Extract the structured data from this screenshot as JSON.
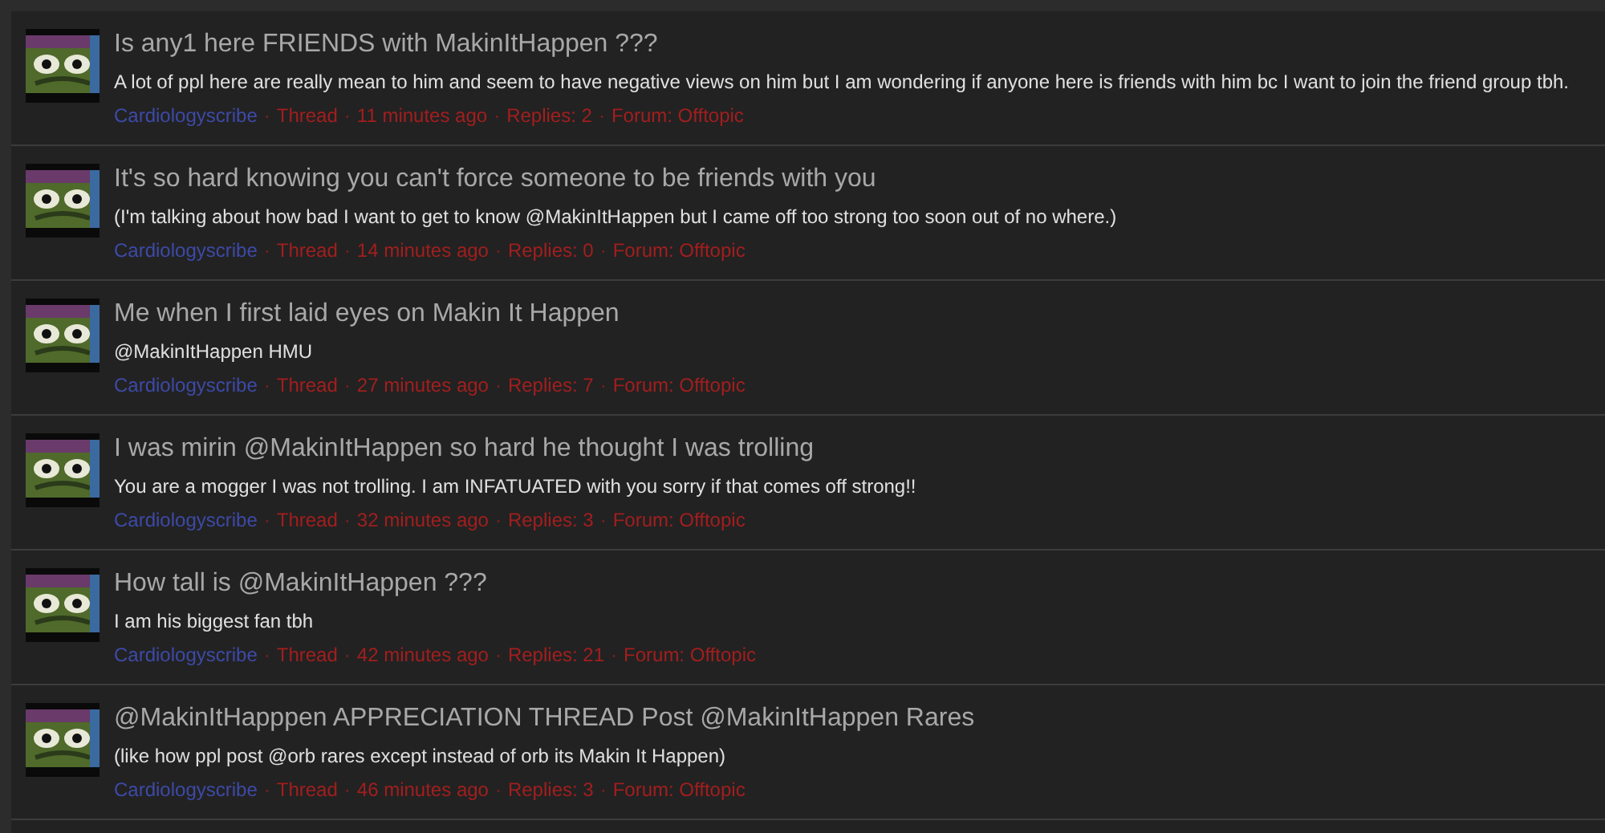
{
  "meta_separator": "·",
  "threads": [
    {
      "title": "Is any1 here FRIENDS with MakinItHappen ???",
      "excerpt": "A lot of ppl here are really mean to him and seem to have negative views on him but I am wondering if anyone here is friends with him bc I want to join the friend group tbh.",
      "author": "Cardiologyscribe",
      "meta": [
        "Thread",
        "11 minutes ago",
        "Replies: 2",
        "Forum: Offtopic"
      ]
    },
    {
      "title": "It's so hard knowing you can't force someone to be friends with you",
      "excerpt": "(I'm talking about how bad I want to get to know @MakinItHappen but I came off too strong too soon out of no where.)",
      "author": "Cardiologyscribe",
      "meta": [
        "Thread",
        "14 minutes ago",
        "Replies: 0",
        "Forum: Offtopic"
      ]
    },
    {
      "title": "Me when I first laid eyes on Makin It Happen",
      "excerpt": "@MakinItHappen HMU",
      "author": "Cardiologyscribe",
      "meta": [
        "Thread",
        "27 minutes ago",
        "Replies: 7",
        "Forum: Offtopic"
      ]
    },
    {
      "title": "I was mirin @MakinItHappen so hard he thought I was trolling",
      "excerpt": "You are a mogger I was not trolling. I am INFATUATED with you sorry if that comes off strong!!",
      "author": "Cardiologyscribe",
      "meta": [
        "Thread",
        "32 minutes ago",
        "Replies: 3",
        "Forum: Offtopic"
      ]
    },
    {
      "title": "How tall is @MakinItHappen ???",
      "excerpt": "I am his biggest fan tbh",
      "author": "Cardiologyscribe",
      "meta": [
        "Thread",
        "42 minutes ago",
        "Replies: 21",
        "Forum: Offtopic"
      ]
    },
    {
      "title": "@MakinItHapppen APPRECIATION THREAD Post @MakinItHappen Rares",
      "excerpt": "(like how ppl post @orb rares except instead of orb its Makin It Happen)",
      "author": "Cardiologyscribe",
      "meta": [
        "Thread",
        "46 minutes ago",
        "Replies: 3",
        "Forum: Offtopic"
      ]
    }
  ]
}
